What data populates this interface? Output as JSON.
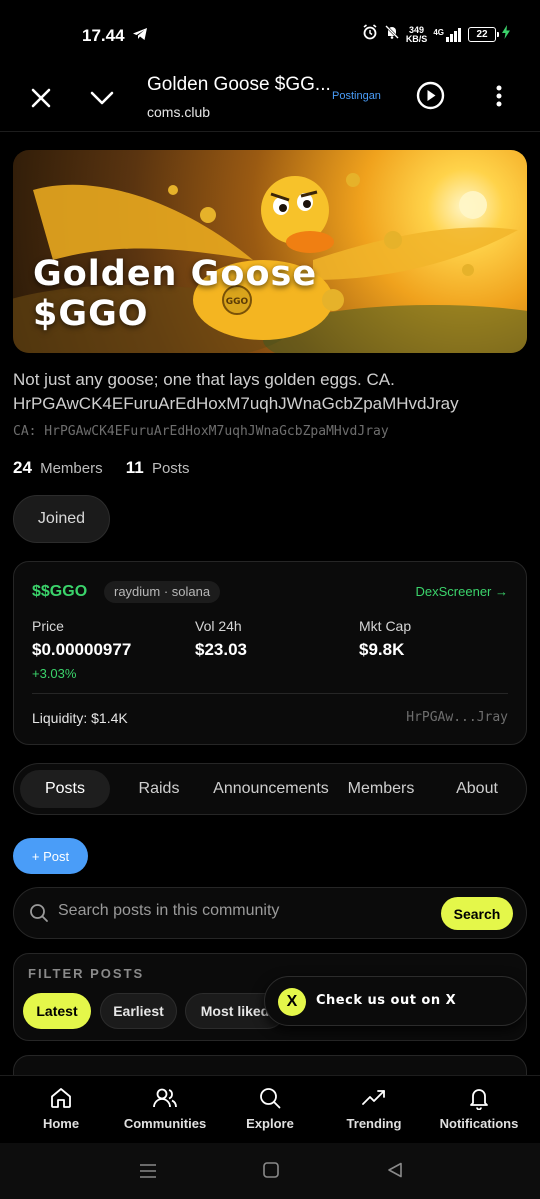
{
  "status": {
    "time": "17.44",
    "speed_top": "349",
    "speed_unit": "KB/S",
    "network": "4G",
    "battery": "22"
  },
  "header": {
    "title": "Golden Goose $GG...",
    "subtitle": "coms.club",
    "tag": "Postingan"
  },
  "banner": {
    "title_line1": "Golden Goose",
    "title_line2": "$GGO",
    "coin_text": "GGO"
  },
  "community": {
    "description": "Not just any goose; one that lays golden eggs. CA. HrPGAwCK4EFuruArEdHoxM7uqhJWnaGcbZpaMHvdJray",
    "ca": "CA: HrPGAwCK4EFuruArEdHoxM7uqhJWnaGcbZpaMHvdJray",
    "members_count": "24",
    "members_label": "Members",
    "posts_count": "11",
    "posts_label": "Posts",
    "joined_label": "Joined"
  },
  "token": {
    "ticker": "$$GGO",
    "chip": "raydium · solana",
    "dex_link": "DexScreener →",
    "price_label": "Price",
    "price_value": "$0.00000977",
    "price_change": "+3.03%",
    "vol_label": "Vol 24h",
    "vol_value": "$23.03",
    "mcap_label": "Mkt Cap",
    "mcap_value": "$9.8K",
    "liquidity": "Liquidity: $1.4K",
    "address_short": "HrPGAw...Jray",
    "accent_color": "#3bd36b"
  },
  "tabs": [
    {
      "label": "Posts",
      "active": true
    },
    {
      "label": "Raids"
    },
    {
      "label": "Announcements"
    },
    {
      "label": "Members"
    },
    {
      "label": "About"
    }
  ],
  "post_button": "+ Post",
  "search": {
    "placeholder": "Search posts in this community",
    "button": "Search"
  },
  "filter": {
    "label": "FILTER POSTS",
    "options": [
      "Latest",
      "Earliest",
      "Most liked"
    ],
    "selected": "Latest"
  },
  "promo": {
    "icon": "X",
    "text": "Check us out on X"
  },
  "nav": [
    {
      "label": "Home",
      "icon": "home-icon"
    },
    {
      "label": "Communities",
      "icon": "users-icon"
    },
    {
      "label": "Explore",
      "icon": "search-icon"
    },
    {
      "label": "Trending",
      "icon": "trending-icon"
    },
    {
      "label": "Notifications",
      "icon": "bell-icon"
    }
  ],
  "colors": {
    "accent_yellow": "#e4f74a",
    "link_blue": "#4a9df8",
    "green": "#3bd36b"
  }
}
